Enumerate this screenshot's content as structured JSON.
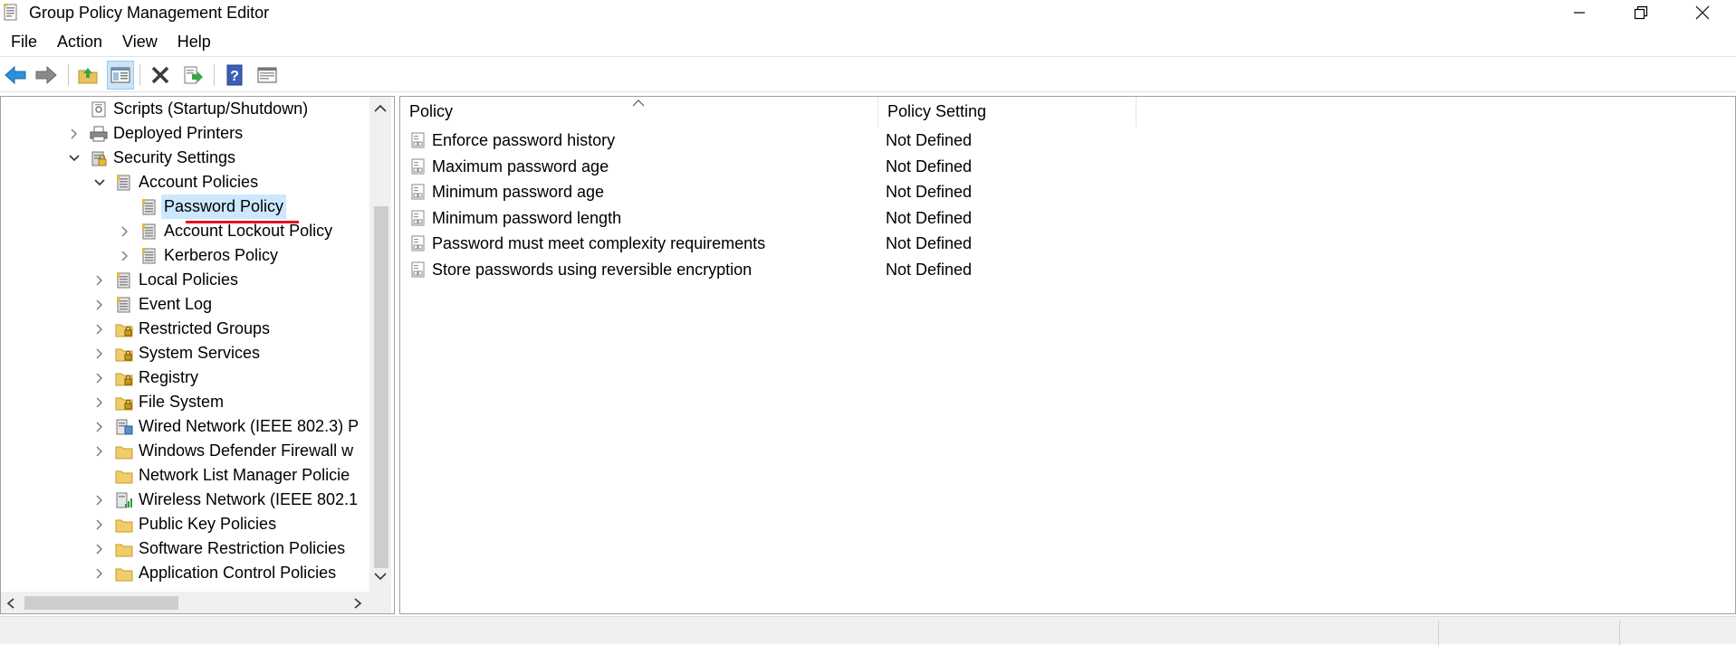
{
  "window": {
    "title": "Group Policy Management Editor",
    "controls": {
      "minimize": "minimize-icon",
      "maximize": "restore-icon",
      "close": "close-icon"
    }
  },
  "menu": [
    "File",
    "Action",
    "View",
    "Help"
  ],
  "toolbar": {
    "buttons": [
      "back-icon",
      "forward-icon",
      "up-folder-icon",
      "show-hide-tree-icon",
      "delete-icon",
      "export-list-icon",
      "help-icon",
      "properties-icon"
    ]
  },
  "tree": {
    "items": [
      {
        "label": "Scripts (Startup/Shutdown)",
        "icon": "script-icon",
        "expander": "none"
      },
      {
        "label": "Deployed Printers",
        "icon": "printer-icon",
        "expander": "collapsed"
      },
      {
        "label": "Security Settings",
        "icon": "security-icon",
        "expander": "expanded"
      },
      {
        "label": "Account Policies",
        "icon": "policy-book-icon",
        "expander": "expanded"
      },
      {
        "label": "Password Policy",
        "icon": "policy-book-icon",
        "expander": "none",
        "selected": true
      },
      {
        "label": "Account Lockout Policy",
        "icon": "policy-book-icon",
        "expander": "collapsed"
      },
      {
        "label": "Kerberos Policy",
        "icon": "policy-book-icon",
        "expander": "collapsed"
      },
      {
        "label": "Local Policies",
        "icon": "policy-book-icon",
        "expander": "collapsed"
      },
      {
        "label": "Event Log",
        "icon": "policy-book-icon",
        "expander": "collapsed"
      },
      {
        "label": "Restricted Groups",
        "icon": "locked-folder-icon",
        "expander": "collapsed"
      },
      {
        "label": "System Services",
        "icon": "locked-folder-icon",
        "expander": "collapsed"
      },
      {
        "label": "Registry",
        "icon": "locked-folder-icon",
        "expander": "collapsed"
      },
      {
        "label": "File System",
        "icon": "locked-folder-icon",
        "expander": "collapsed"
      },
      {
        "label": "Wired Network (IEEE 802.3) P",
        "icon": "network-icon",
        "expander": "collapsed"
      },
      {
        "label": "Windows Defender Firewall w",
        "icon": "folder-icon",
        "expander": "collapsed"
      },
      {
        "label": "Network List Manager Policie",
        "icon": "folder-icon",
        "expander": "none"
      },
      {
        "label": "Wireless Network (IEEE 802.1",
        "icon": "wireless-icon",
        "expander": "collapsed"
      },
      {
        "label": "Public Key Policies",
        "icon": "folder-icon",
        "expander": "collapsed"
      },
      {
        "label": "Software Restriction Policies",
        "icon": "folder-icon",
        "expander": "collapsed"
      },
      {
        "label": "Application Control Policies",
        "icon": "folder-icon",
        "expander": "collapsed"
      }
    ]
  },
  "list": {
    "columns": [
      "Policy",
      "Policy Setting"
    ],
    "sort_column": "Policy",
    "rows": [
      {
        "policy": "Enforce password history",
        "setting": "Not Defined"
      },
      {
        "policy": "Maximum password age",
        "setting": "Not Defined"
      },
      {
        "policy": "Minimum password age",
        "setting": "Not Defined"
      },
      {
        "policy": "Minimum password length",
        "setting": "Not Defined"
      },
      {
        "policy": "Password must meet complexity requirements",
        "setting": "Not Defined"
      },
      {
        "policy": "Store passwords using reversible encryption",
        "setting": "Not Defined"
      }
    ]
  },
  "colors": {
    "selection": "#cce8ff",
    "highlight_underline": "#e81123",
    "toolbar_active": "#cce4f7"
  }
}
